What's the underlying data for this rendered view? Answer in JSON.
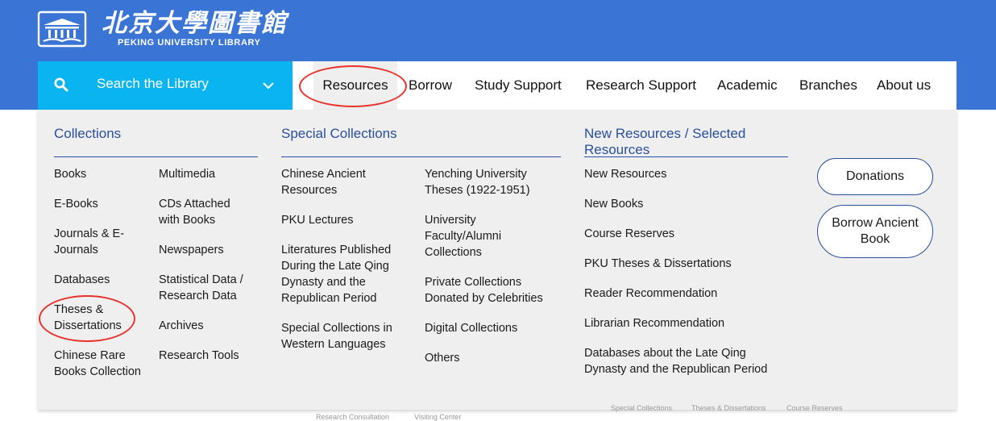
{
  "colors": {
    "header_blue": "#3a75d6",
    "search_cyan": "#0ab4f0",
    "link_blue": "#2a4f9e",
    "annotation_red": "#e8322c",
    "dropdown_gray": "#efefef"
  },
  "logo": {
    "cn": "北京大學圖書館",
    "en": "PEKING UNIVERSITY LIBRARY",
    "emblem_icon": "open-book-emblem-icon"
  },
  "search": {
    "label": "Search the Library",
    "icon": "search-icon",
    "chevron_icon": "chevron-down-icon"
  },
  "nav": {
    "items": [
      {
        "label": "Resources",
        "active": true
      },
      {
        "label": "Borrow"
      },
      {
        "label": "Study Support"
      },
      {
        "label": "Research Support"
      },
      {
        "label": "Academic"
      },
      {
        "label": "Branches"
      },
      {
        "label": "About us"
      }
    ]
  },
  "dropdown": {
    "collections": {
      "title": "Collections",
      "left": [
        "Books",
        "E-Books",
        "Journals & E-Journals",
        "Databases",
        "Theses & Dissertations",
        "Chinese Rare Books Collection"
      ],
      "right": [
        "Multimedia",
        "CDs Attached with Books",
        "Newspapers",
        "Statistical Data / Research Data",
        "Archives",
        "Research Tools"
      ]
    },
    "special": {
      "title": "Special Collections",
      "left": [
        "Chinese Ancient Resources",
        "PKU Lectures",
        "Literatures Published During the Late Qing Dynasty and the Republican Period",
        "Special Collections in Western Languages"
      ],
      "right": [
        "Yenching University Theses (1922-1951)",
        "University Faculty/Alumni Collections",
        "Private Collections Donated by Celebrities",
        "Digital Collections",
        "Others"
      ]
    },
    "new_resources": {
      "title": "New Resources / Selected Resources",
      "items": [
        "New Resources",
        "New Books",
        "Course Reserves",
        "PKU Theses & Dissertations",
        "Reader Recommendation",
        "Librarian Recommendation",
        "Databases about the Late Qing Dynasty and the Republican Period"
      ]
    },
    "buttons": {
      "donations": "Donations",
      "borrow_ancient": "Borrow Ancient Book"
    }
  },
  "footer_hint": {
    "items": [
      "Special Collections",
      "Theses & Dissertations",
      "Course Reserves"
    ],
    "lower_items": [
      "Research Consultation",
      "Visiting Center"
    ]
  }
}
